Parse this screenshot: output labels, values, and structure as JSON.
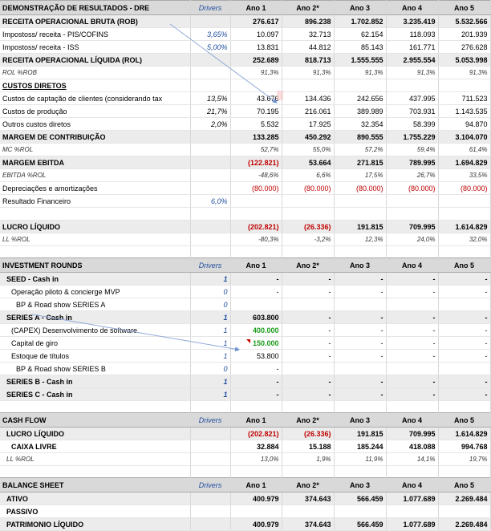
{
  "dre": {
    "title": "DEMONSTRAÇÃO DE RESULTADOS - DRE",
    "drivers_label": "Drivers",
    "years": [
      "Ano 1",
      "Ano 2*",
      "Ano 3",
      "Ano 4",
      "Ano 5"
    ],
    "rows": [
      {
        "label": "RECEITA OPERACIONAL BRUTA (ROB)",
        "driver": "",
        "values": [
          "276.617",
          "896.238",
          "1.702.852",
          "3.235.419",
          "5.532.566"
        ],
        "style": "bold band"
      },
      {
        "label": "Impostoss/ receita - PIS/COFINS",
        "driver": "3,65%",
        "values": [
          "10.097",
          "32.713",
          "62.154",
          "118.093",
          "201.939"
        ],
        "style": ""
      },
      {
        "label": "Impostoss/ receita - ISS",
        "driver": "5,00%",
        "values": [
          "13.831",
          "44.812",
          "85.143",
          "161.771",
          "276.628"
        ],
        "style": ""
      },
      {
        "label": "RECEITA OPERACIONAL LÍQUIDA (ROL)",
        "driver": "",
        "values": [
          "252.689",
          "818.713",
          "1.555.555",
          "2.955.554",
          "5.053.998"
        ],
        "style": "bold band"
      },
      {
        "label": "ROL %ROB",
        "driver": "",
        "values": [
          "91,3%",
          "91,3%",
          "91,3%",
          "91,3%",
          "91,3%"
        ],
        "style": "pct"
      },
      {
        "label": "CUSTOS DIRETOS",
        "driver": "",
        "values": [
          "",
          "",
          "",
          "",
          ""
        ],
        "style": "bold underline"
      },
      {
        "label": "Custos de captação de clientes (considerando tax",
        "driver": "13,5%",
        "values": [
          "43.676",
          "134.436",
          "242.656",
          "437.995",
          "711.523"
        ],
        "style": "black-driver"
      },
      {
        "label": "Custos de produção",
        "driver": "21,7%",
        "values": [
          "70.195",
          "216.061",
          "389.989",
          "703.931",
          "1.143.535"
        ],
        "style": "black-driver"
      },
      {
        "label": "Outros custos diretos",
        "driver": "2,0%",
        "values": [
          "5.532",
          "17.925",
          "32.354",
          "58.399",
          "94.870"
        ],
        "style": "black-driver"
      },
      {
        "label": "MARGEM DE CONTRIBUIÇÃO",
        "driver": "",
        "values": [
          "133.285",
          "450.292",
          "890.555",
          "1.755.229",
          "3.104.070"
        ],
        "style": "bold band"
      },
      {
        "label": "MC %ROL",
        "driver": "",
        "values": [
          "52,7%",
          "55,0%",
          "57,2%",
          "59,4%",
          "61,4%"
        ],
        "style": "pct"
      },
      {
        "label": "MARGEM EBITDA",
        "driver": "",
        "values": [
          "(122.821)",
          "53.664",
          "271.815",
          "789.995",
          "1.694.829"
        ],
        "style": "bold band",
        "neg": [
          0
        ]
      },
      {
        "label": "EBITDA %ROL",
        "driver": "",
        "values": [
          "-48,6%",
          "6,6%",
          "17,5%",
          "26,7%",
          "33,5%"
        ],
        "style": "pct"
      },
      {
        "label": "Depreciações e amortizações",
        "driver": "",
        "values": [
          "(80.000)",
          "(80.000)",
          "(80.000)",
          "(80.000)",
          "(80.000)"
        ],
        "style": "",
        "neg": [
          0,
          1,
          2,
          3,
          4
        ]
      },
      {
        "label": "Resultado Financeiro",
        "driver": "6,0%",
        "values": [
          "",
          "",
          "",
          "",
          ""
        ],
        "style": ""
      },
      {
        "label": "",
        "driver": "",
        "values": [
          "",
          "",
          "",
          "",
          ""
        ],
        "style": ""
      },
      {
        "label": "LUCRO LÍQUIDO",
        "driver": "",
        "values": [
          "(202.821)",
          "(26.336)",
          "191.815",
          "709.995",
          "1.614.829"
        ],
        "style": "bold band",
        "neg": [
          0,
          1
        ]
      },
      {
        "label": "LL %ROL",
        "driver": "",
        "values": [
          "-80,3%",
          "-3,2%",
          "12,3%",
          "24,0%",
          "32,0%"
        ],
        "style": "pct"
      }
    ]
  },
  "investment": {
    "title": "INVESTMENT ROUNDS",
    "drivers_label": "Drivers",
    "years": [
      "Ano 1",
      "Ano 2*",
      "Ano 3",
      "Ano 4",
      "Ano 5"
    ],
    "rows": [
      {
        "label": "SEED - Cash in",
        "driver": "1",
        "values": [
          "-",
          "-",
          "-",
          "-",
          "-"
        ],
        "style": "bold band ind3"
      },
      {
        "label": "Operação piloto & concierge MVP",
        "driver": "0",
        "values": [
          "-",
          "-",
          "-",
          "-",
          "-"
        ],
        "style": "ind"
      },
      {
        "label": "BP & Road show SERIES A",
        "driver": "0",
        "values": [
          "",
          "",
          "",
          "",
          ""
        ],
        "style": "ind2"
      },
      {
        "label": "SERIES A  - Cash in",
        "driver": "1",
        "values": [
          "603.800",
          "-",
          "-",
          "-",
          "-"
        ],
        "style": "bold band ind3"
      },
      {
        "label": "(CAPEX) Desenvolvimento de software",
        "driver": "1",
        "values": [
          "400.000",
          "-",
          "-",
          "-",
          "-"
        ],
        "style": "ind",
        "green": [
          0
        ]
      },
      {
        "label": "Capital de giro",
        "driver": "1",
        "values": [
          "150.000",
          "-",
          "-",
          "-",
          "-"
        ],
        "style": "ind",
        "green": [
          0
        ]
      },
      {
        "label": "Estoque de títulos",
        "driver": "1",
        "values": [
          "53.800",
          "-",
          "-",
          "-",
          "-"
        ],
        "style": "ind"
      },
      {
        "label": "BP & Road show SERIES B",
        "driver": "0",
        "values": [
          "-",
          "",
          "",
          "",
          ""
        ],
        "style": "ind2"
      },
      {
        "label": "SERIES B  - Cash in",
        "driver": "1",
        "values": [
          "-",
          "-",
          "-",
          "-",
          "-"
        ],
        "style": "bold band ind3"
      },
      {
        "label": "SERIES C  - Cash in",
        "driver": "1",
        "values": [
          "-",
          "-",
          "-",
          "-",
          "-"
        ],
        "style": "bold band ind3"
      }
    ]
  },
  "cashflow": {
    "title": "CASH FLOW",
    "drivers_label": "Drivers",
    "years": [
      "Ano 1",
      "Ano 2*",
      "Ano 3",
      "Ano 4",
      "Ano 5"
    ],
    "rows": [
      {
        "label": "LUCRO LÍQUIDO",
        "driver": "",
        "values": [
          "(202.821)",
          "(26.336)",
          "191.815",
          "709.995",
          "1.614.829"
        ],
        "style": "bold band ind3",
        "neg": [
          0,
          1
        ]
      },
      {
        "label": "CAIXA LIVRE",
        "driver": "",
        "values": [
          "32.884",
          "15.188",
          "185.244",
          "418.088",
          "994.768"
        ],
        "style": "bold ind"
      },
      {
        "label": "LL %ROL",
        "driver": "",
        "values": [
          "13,0%",
          "1,9%",
          "11,9%",
          "14,1%",
          "19,7%"
        ],
        "style": "pct ind3"
      }
    ]
  },
  "balance": {
    "title": "BALANCE SHEET",
    "drivers_label": "Drivers",
    "years": [
      "Ano 1",
      "Ano 2*",
      "Ano 3",
      "Ano 4",
      "Ano 5"
    ],
    "rows": [
      {
        "label": "ATIVO",
        "driver": "",
        "values": [
          "400.979",
          "374.643",
          "566.459",
          "1.077.689",
          "2.269.484"
        ],
        "style": "bold band ind3"
      },
      {
        "label": "PASSIVO",
        "driver": "",
        "values": [
          "",
          "",
          "",
          "",
          ""
        ],
        "style": "bold ind3"
      },
      {
        "label": "PATRIMONIO LÍQUIDO",
        "driver": "",
        "values": [
          "400.979",
          "374.643",
          "566.459",
          "1.077.689",
          "2.269.484"
        ],
        "style": "bold band ind3"
      }
    ]
  },
  "colors": {
    "header_bg": "#d9d9d9",
    "band_bg": "#ececec",
    "negative": "#c00000",
    "positive_highlight": "#1a9a1a",
    "driver_text": "#1f4e9e"
  }
}
